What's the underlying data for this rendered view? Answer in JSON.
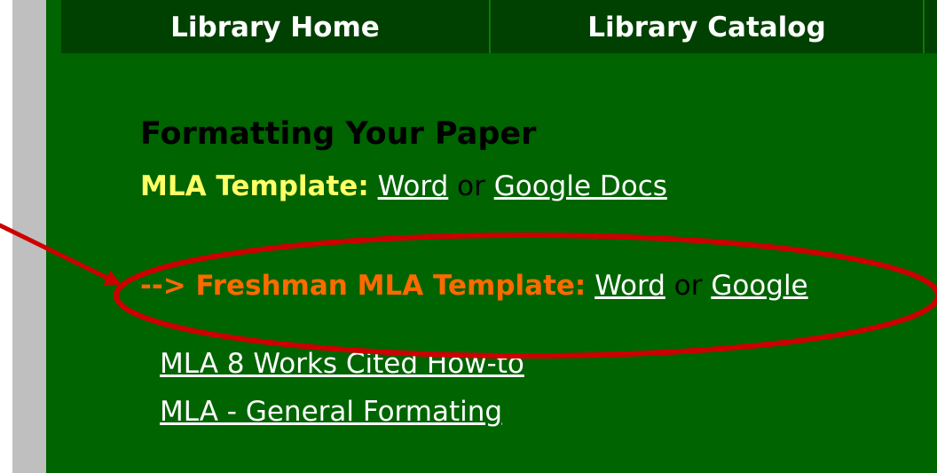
{
  "nav": {
    "items": [
      {
        "label": "Library Home"
      },
      {
        "label": "Library Catalog"
      }
    ]
  },
  "section": {
    "title": "Formatting Your Paper"
  },
  "mla_template": {
    "label": "MLA Template:",
    "word": "Word",
    "or": "or",
    "google": "Google Docs"
  },
  "freshman_template": {
    "label": "--> Freshman MLA Template:",
    "word": "Word",
    "or": "or",
    "google": "Google"
  },
  "links": {
    "works_cited": "MLA 8 Works Cited How-to",
    "general_formatting": "MLA - General Formating"
  },
  "colors": {
    "page_green": "#006400",
    "nav_green": "#004000",
    "yellow_label": "#ffff66",
    "orange_label": "#ff6a00",
    "annotation_red": "#cc0000",
    "link_white": "#ffffff"
  },
  "icons": {
    "annotation_arrow": "red-arrow-icon",
    "highlight_ellipse": "red-ellipse-icon"
  }
}
